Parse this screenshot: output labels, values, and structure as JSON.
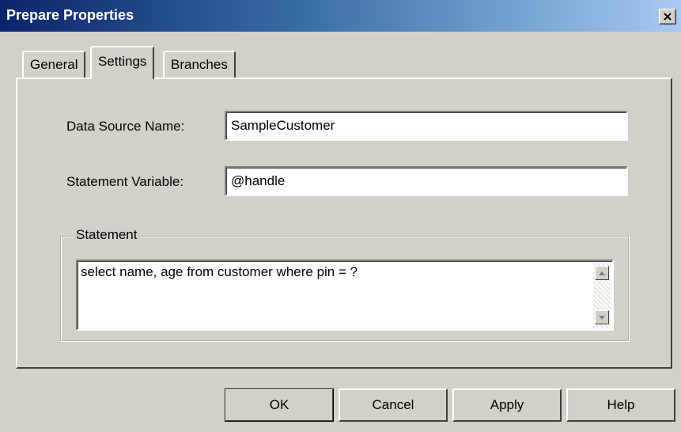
{
  "window": {
    "title": "Prepare Properties"
  },
  "tabs": [
    {
      "label": "General"
    },
    {
      "label": "Settings"
    },
    {
      "label": "Branches"
    }
  ],
  "form": {
    "data_source_label": "Data Source Name:",
    "data_source_value": "SampleCustomer",
    "statement_variable_label": "Statement Variable:",
    "statement_variable_value": "@handle",
    "statement_group_label": "Statement",
    "statement_text": "select name, age from customer where pin = ?"
  },
  "buttons": {
    "ok": "OK",
    "cancel": "Cancel",
    "apply": "Apply",
    "help": "Help"
  },
  "icons": {
    "close": "close-icon",
    "scroll_up": "arrow-up-icon",
    "scroll_down": "arrow-down-icon"
  },
  "colors": {
    "title_start": "#0a246a",
    "title_end": "#a6caf0",
    "face": "#d4d0c8"
  }
}
